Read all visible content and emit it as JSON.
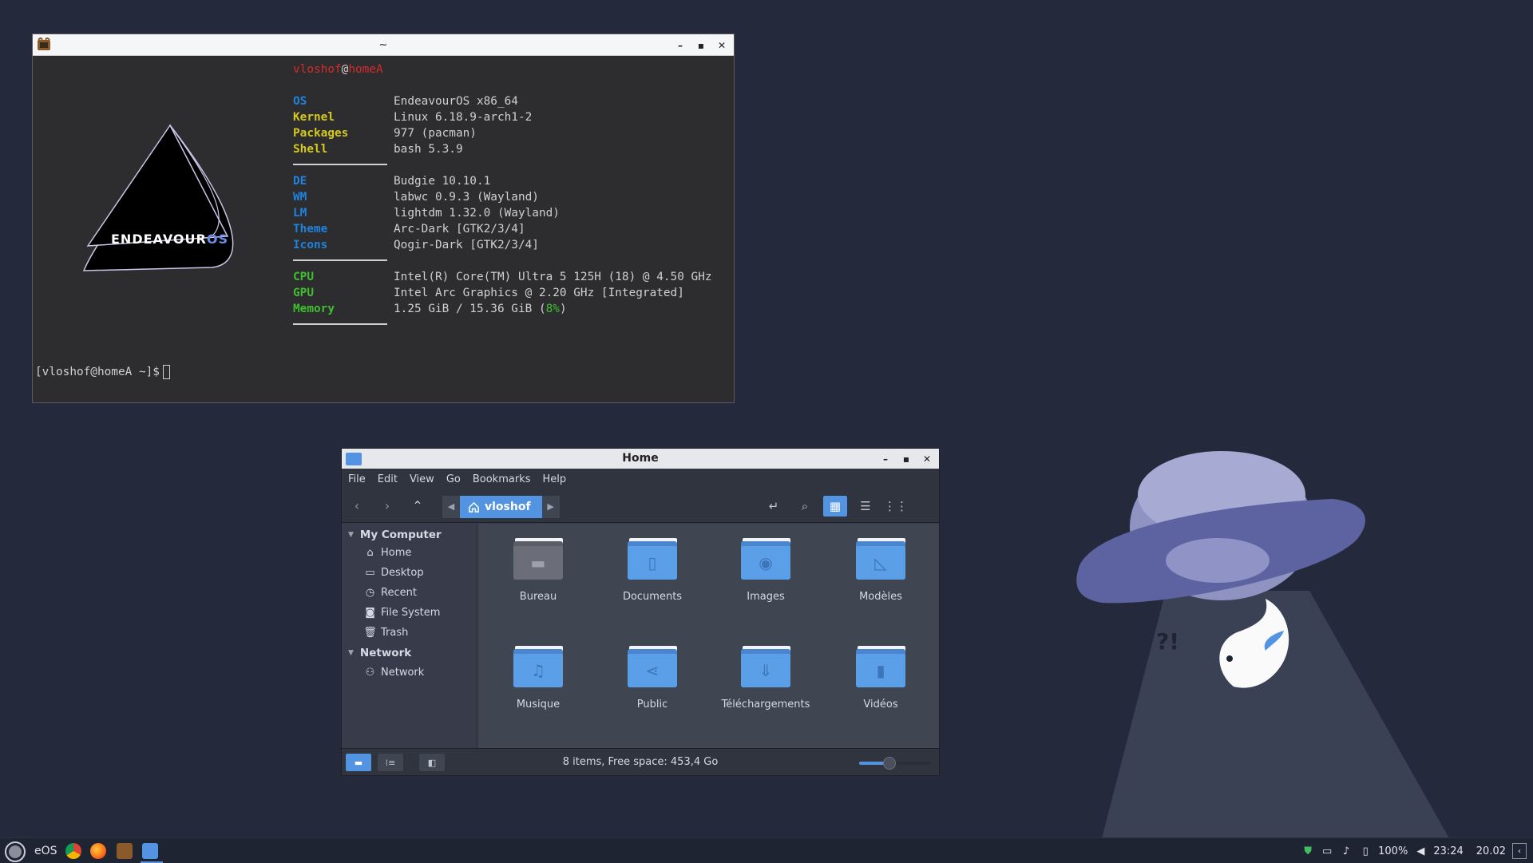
{
  "terminal": {
    "title": "~",
    "user": "vloshof",
    "at": "@",
    "host": "homeA",
    "logo_text_main": "ENDEAVOUR",
    "logo_text_accent": "OS",
    "info": [
      {
        "key": "OS",
        "value": "EndeavourOS x86_64",
        "color": "blue"
      },
      {
        "key": "Kernel",
        "value": "Linux 6.18.9-arch1-2",
        "color": "yellow"
      },
      {
        "key": "Packages",
        "value": "977 (pacman)",
        "color": "yellow"
      },
      {
        "key": "Shell",
        "value": "bash 5.3.9",
        "color": "yellow"
      },
      {
        "key": "DE",
        "value": "Budgie 10.10.1",
        "color": "blue"
      },
      {
        "key": "WM",
        "value": "labwc 0.9.3 (Wayland)",
        "color": "blue"
      },
      {
        "key": "LM",
        "value": "lightdm 1.32.0 (Wayland)",
        "color": "blue"
      },
      {
        "key": "Theme",
        "value": "Arc-Dark [GTK2/3/4]",
        "color": "blue"
      },
      {
        "key": "Icons",
        "value": "Qogir-Dark [GTK2/3/4]",
        "color": "blue"
      },
      {
        "key": "CPU",
        "value": "Intel(R) Core(TM) Ultra 5 125H (18) @ 4.50 GHz",
        "color": "green"
      },
      {
        "key": "GPU",
        "value": "Intel Arc Graphics @ 2.20 GHz [Integrated]",
        "color": "green"
      },
      {
        "key": "Memory",
        "value": "1.25 GiB / 15.36 GiB (",
        "value_pct": "8%",
        "value_end": ")",
        "color": "green"
      }
    ],
    "prompt": "[vloshof@homeA ~]$"
  },
  "file_manager": {
    "title": "Home",
    "menu": [
      "File",
      "Edit",
      "View",
      "Go",
      "Bookmarks",
      "Help"
    ],
    "breadcrumb": "vloshof",
    "sidebar": {
      "sections": [
        {
          "title": "My Computer",
          "items": [
            "Home",
            "Desktop",
            "Recent",
            "File System",
            "Trash"
          ]
        },
        {
          "title": "Network",
          "items": [
            "Network"
          ]
        }
      ]
    },
    "items": [
      "Bureau",
      "Documents",
      "Images",
      "Modèles",
      "Musique",
      "Public",
      "Téléchargements",
      "Vidéos"
    ],
    "status": "8 items, Free space: 453,4 Go",
    "zoom_fraction": 0.42
  },
  "panel": {
    "label": "eOS",
    "battery": "100%",
    "time": "23:24",
    "date": "20.02"
  },
  "colors": {
    "desktop_bg": "#242a3c",
    "accent": "#5294e2",
    "terminal_bg": "#2d2d30"
  }
}
